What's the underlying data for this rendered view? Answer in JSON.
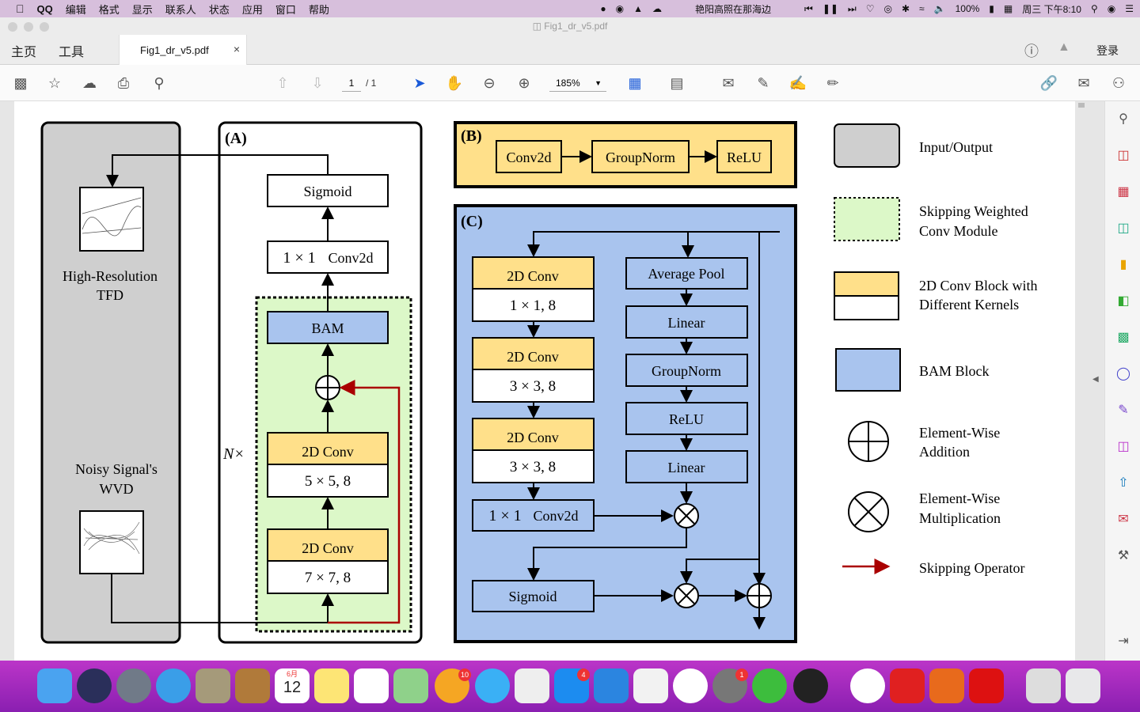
{
  "menubar": {
    "apple": "",
    "items": [
      "QQ",
      "编辑",
      "格式",
      "显示",
      "联系人",
      "状态",
      "应用",
      "窗口",
      "帮助"
    ],
    "song": "艳阳高照在那海边",
    "battery": "100%",
    "datetime": "周三 下午8:10"
  },
  "window": {
    "title": "Fig1_dr_v5.pdf"
  },
  "tabs": {
    "home": "主页",
    "tools": "工具",
    "doc": "Fig1_dr_v5.pdf",
    "close": "×",
    "login": "登录"
  },
  "toolbar": {
    "page_current": "1",
    "page_total": "/ 1",
    "zoom": "185%"
  },
  "figure": {
    "panel_a": {
      "label": "(A)",
      "sigmoid": "Sigmoid",
      "conv1x1_a": "1 × 1",
      "conv1x1_b": "Conv2d",
      "bam": "BAM",
      "n_times": "N×",
      "conv5_title": "2D Conv",
      "conv5_kernel": "5 × 5, 8",
      "conv7_title": "2D Conv",
      "conv7_kernel": "7 × 7, 8"
    },
    "io_panel": {
      "tfd_line1": "High-Resolution",
      "tfd_line2": "TFD",
      "wvd_line1": "Noisy Signal's",
      "wvd_line2": "WVD"
    },
    "panel_b": {
      "label": "(B)",
      "conv2d": "Conv2d",
      "groupnorm": "GroupNorm",
      "relu": "ReLU"
    },
    "panel_c": {
      "label": "(C)",
      "conv_a_title": "2D Conv",
      "conv_a_kernel": "1 × 1, 8",
      "conv_b_title": "2D Conv",
      "conv_b_kernel": "3 × 3, 8",
      "conv_c_title": "2D Conv",
      "conv_c_kernel": "3 × 3, 8",
      "conv1x1_a": "1 × 1",
      "conv1x1_b": "Conv2d",
      "sigmoid": "Sigmoid",
      "avgpool": "Average Pool",
      "linear1": "Linear",
      "groupnorm": "GroupNorm",
      "relu": "ReLU",
      "linear2": "Linear"
    },
    "legend": {
      "io": "Input/Output",
      "skip1": "Skipping Weighted",
      "skip2": "Conv Module",
      "conv1": "2D Conv Block with",
      "conv2": "Different Kernels",
      "bam": "BAM Block",
      "add1": "Element-Wise",
      "add2": "Addition",
      "mul1": "Element-Wise",
      "mul2": "Multiplication",
      "skipop": "Skipping Operator"
    }
  },
  "dock": {
    "calendar_month": "6月",
    "calendar_day": "12",
    "badges": {
      "photos": "10",
      "appstore": "4",
      "prefs": "1"
    }
  },
  "colors": {
    "menubar": "#d7bfdc",
    "dock": "#a22bc0",
    "yellow": "#ffe08a",
    "blue": "#a9c4ee",
    "green": "#dcf8c8",
    "gray": "#cfcfcf",
    "skip_red": "#aa0000"
  }
}
